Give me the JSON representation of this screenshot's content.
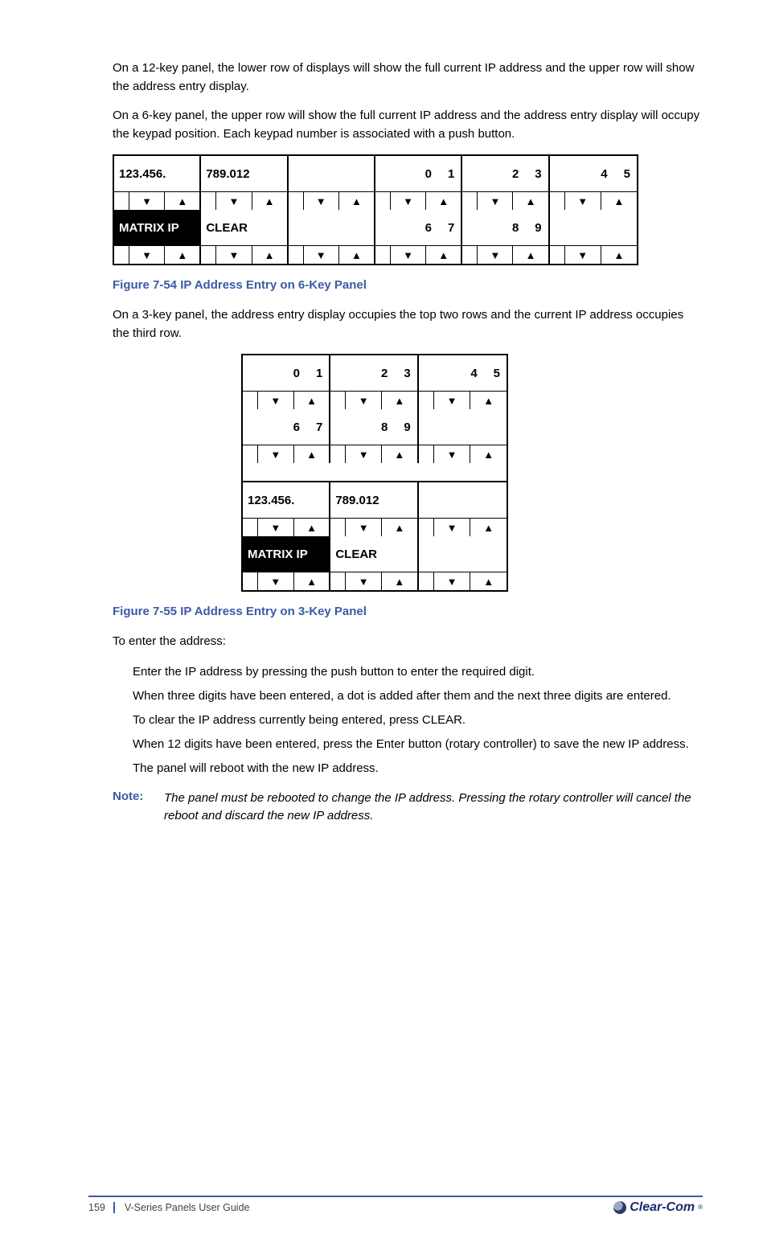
{
  "intro1": "On a 12-key panel, the lower row of displays will show the full current IP address and the upper row will show the address entry display.",
  "intro2": "On a 6-key panel, the upper row will show the full current IP address and the address entry display will occupy the keypad position. Each keypad number is associated with a push button.",
  "fig1": {
    "row1": [
      "123.456.",
      "789.012",
      "",
      "0__1",
      "2__3",
      "4__5"
    ],
    "row2": [
      "MATRIX IP",
      "CLEAR",
      "",
      "6__7",
      "8__9",
      ""
    ]
  },
  "figcap1": "Figure 7-54 IP Address Entry on 6-Key Panel",
  "after1": "On a 3-key panel, the address entry display occupies the top two rows and the current IP address occupies the third row.",
  "fig2": {
    "row1": [
      "0__1",
      "2__3",
      "4__5"
    ],
    "row2": [
      "6__7",
      "8__9",
      ""
    ],
    "row3": [
      "123.456.",
      "789.012",
      ""
    ],
    "row4": [
      "MATRIX IP",
      "CLEAR",
      ""
    ]
  },
  "figcap2": "Figure 7-55 IP Address Entry on 3-Key Panel",
  "entrypara": "To enter the address:",
  "steps": [
    "Enter the IP address by pressing the push button to enter the required digit.",
    "When three digits have been entered, a dot is added after them and the next three digits are entered.",
    "To clear the IP address currently being entered, press CLEAR.",
    "When 12 digits have been entered, press the Enter button (rotary controller) to save the new IP address.",
    "The panel will reboot with the new IP address."
  ],
  "notelabel": "Note:",
  "notetext": "The panel must be rebooted to change the IP address. Pressing the rotary controller will cancel the reboot and discard the new IP address.",
  "footer": {
    "page": "159",
    "doctitle": "V-Series Panels User Guide"
  },
  "logo": "Clear-Com"
}
